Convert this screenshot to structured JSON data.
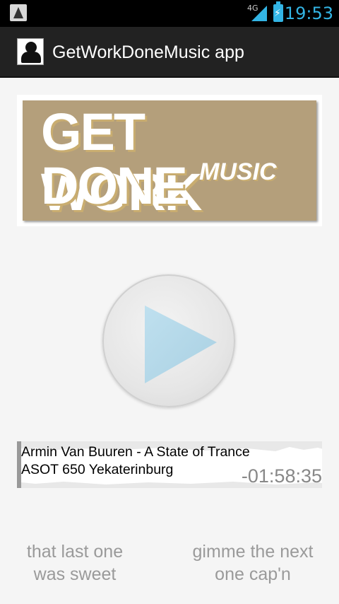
{
  "status_bar": {
    "network": "4G",
    "time": "19:53",
    "accent_color": "#33b5e5"
  },
  "app": {
    "title": "GetWorkDoneMusic app"
  },
  "banner": {
    "line1": "GET WORK",
    "line2": "DONE",
    "music": "MUSIC",
    "background_color": "#b49f7b"
  },
  "player": {
    "play_icon": "play-icon",
    "track_title_line1": "Armin Van Buuren - A State of Trance",
    "track_title_line2": "ASOT 650 Yekaterinburg",
    "time_remaining": "-01:58:35"
  },
  "actions": {
    "like_label_line1": "that last one",
    "like_label_line2": "was sweet",
    "next_label_line1": "gimme the next",
    "next_label_line2": "one cap'n"
  }
}
